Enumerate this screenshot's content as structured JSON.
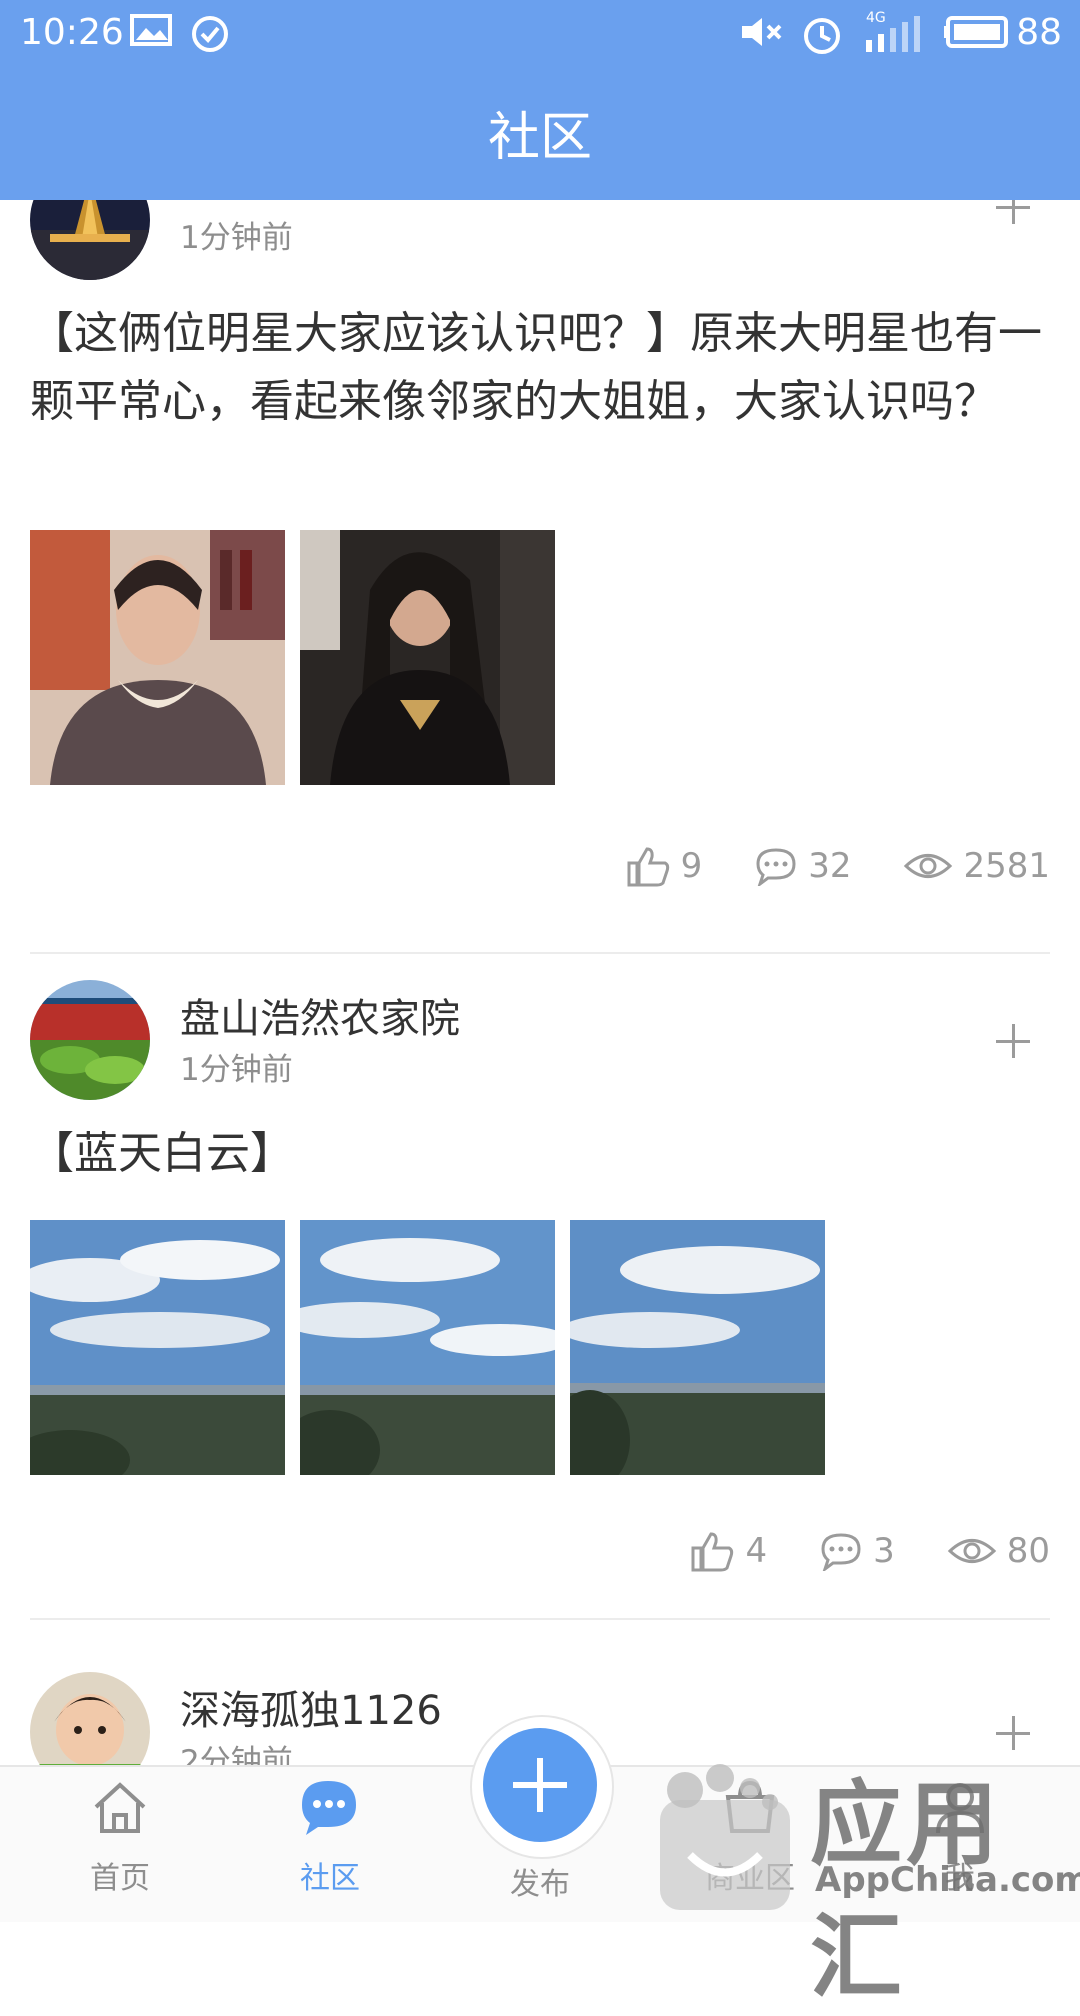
{
  "status_bar": {
    "time": "10:26",
    "network": "4G",
    "battery": "88",
    "icons": [
      "image-icon",
      "check-circle-icon",
      "mute-icon",
      "alarm-icon",
      "signal-icon",
      "battery-icon"
    ]
  },
  "header": {
    "title": "社区"
  },
  "colors": {
    "accent": "#6aa0ee",
    "active": "#5b9cf0",
    "muted": "#9b9b9b"
  },
  "posts": [
    {
      "author": "",
      "time": "1分钟前",
      "text": "【这俩位明星大家应该认识吧？】原来大明星也有一颗平常心，看起来像邻家的大姐姐，大家认识吗？",
      "likes": "9",
      "comments": "32",
      "views": "2581"
    },
    {
      "author": "盘山浩然农家院",
      "time": "1分钟前",
      "text": "【蓝天白云】",
      "likes": "4",
      "comments": "3",
      "views": "80"
    },
    {
      "author": "深海孤独1126",
      "time": "2分钟前"
    }
  ],
  "bottom_nav": {
    "items": [
      {
        "label": "首页",
        "icon": "home-icon"
      },
      {
        "label": "社区",
        "icon": "chat-bubble-icon"
      },
      {
        "label": "发布",
        "icon": "plus-icon"
      },
      {
        "label": "商业区",
        "icon": "shop-icon"
      },
      {
        "label": "我",
        "icon": "user-icon"
      }
    ],
    "active": "社区"
  },
  "watermark": {
    "cn": "应用汇",
    "en": "AppChina.com"
  }
}
